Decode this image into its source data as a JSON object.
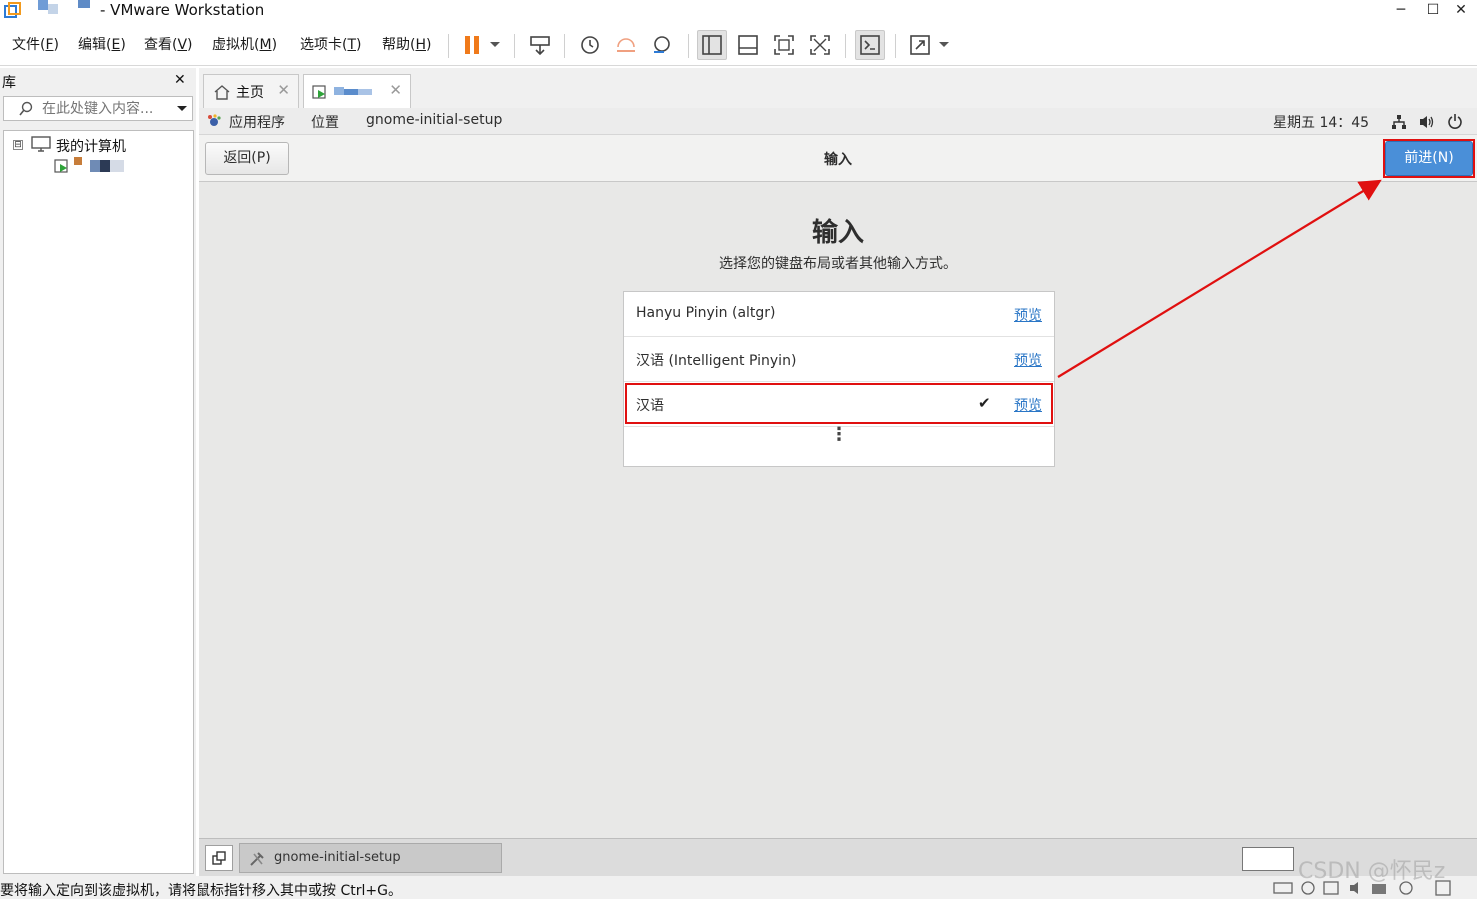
{
  "window": {
    "title": "- VMware Workstation",
    "minimize": "─",
    "maximize": "☐",
    "close": "✕"
  },
  "menu": [
    {
      "label": "文件(",
      "key": "F",
      "end": ")"
    },
    {
      "label": "编辑(",
      "key": "E",
      "end": ")"
    },
    {
      "label": "查看(",
      "key": "V",
      "end": ")"
    },
    {
      "label": "虚拟机(",
      "key": "M",
      "end": ")"
    },
    {
      "label": "选项卡(",
      "key": "T",
      "end": ")"
    },
    {
      "label": "帮助(",
      "key": "H",
      "end": ")"
    }
  ],
  "library": {
    "title": "库",
    "close": "✕",
    "search_placeholder": "在此处键入内容...",
    "tree_expander": "⊟",
    "tree_root": "我的计算机"
  },
  "tabs": {
    "home_label": "主页",
    "close": "✕"
  },
  "gnome_topbar": {
    "apps": "应用程序",
    "places": "位置",
    "window_name": "gnome-initial-setup",
    "clock": "星期五 14：45"
  },
  "header": {
    "back": "返回(P)",
    "title": "输入",
    "next": "前进(N)"
  },
  "page": {
    "heading": "输入",
    "subtitle": "选择您的键盘布局或者其他输入方式。",
    "rows": [
      {
        "label": "Hanyu Pinyin (altgr)",
        "preview": "预览",
        "selected": false
      },
      {
        "label": "汉语 (Intelligent Pinyin)",
        "preview": "预览",
        "selected": false
      },
      {
        "label": "汉语",
        "preview": "预览",
        "selected": true,
        "check": "✔"
      }
    ],
    "more": "⋮"
  },
  "taskbar": {
    "window_label": "gnome-initial-setup"
  },
  "status": {
    "text": "要将输入定向到该虚拟机，请将鼠标指针移入其中或按 Ctrl+G。",
    "watermark": "CSDN @怀民z"
  },
  "colors": {
    "accent": "#4a8fd8",
    "annotation": "#e01010",
    "link": "#2a76c6"
  }
}
